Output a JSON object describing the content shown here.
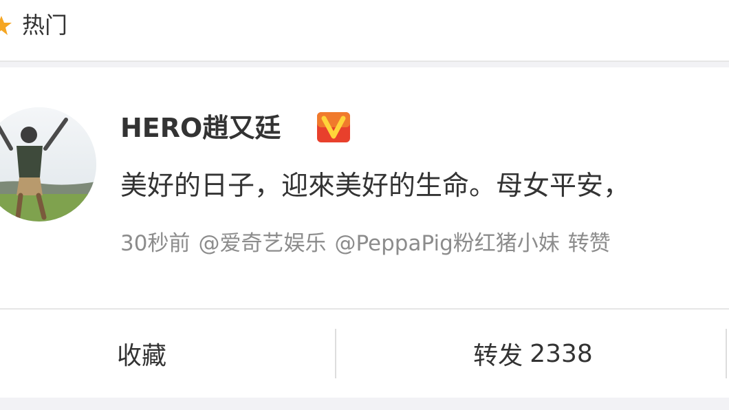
{
  "tab_bar": {
    "hot_icon": "star-icon",
    "hot_label": "热门"
  },
  "post": {
    "author": {
      "name": "HERO趙又廷",
      "verified_badge": "V"
    },
    "text": "美好的日子，迎來美好的生命。母女平安，",
    "meta": {
      "time": "30秒前",
      "mention_1": "@爱奇艺娱乐",
      "mention_2": "@PeppaPig粉红猪小妹",
      "trailing": "转赞"
    }
  },
  "actions": {
    "favorite_label": "收藏",
    "repost_label": "转发",
    "repost_count": "2338"
  },
  "colors": {
    "badge_orange": "#f5a623",
    "badge_red": "#e8402c",
    "meta_gray": "#8c8c8c",
    "background": "#f2f2f5"
  }
}
